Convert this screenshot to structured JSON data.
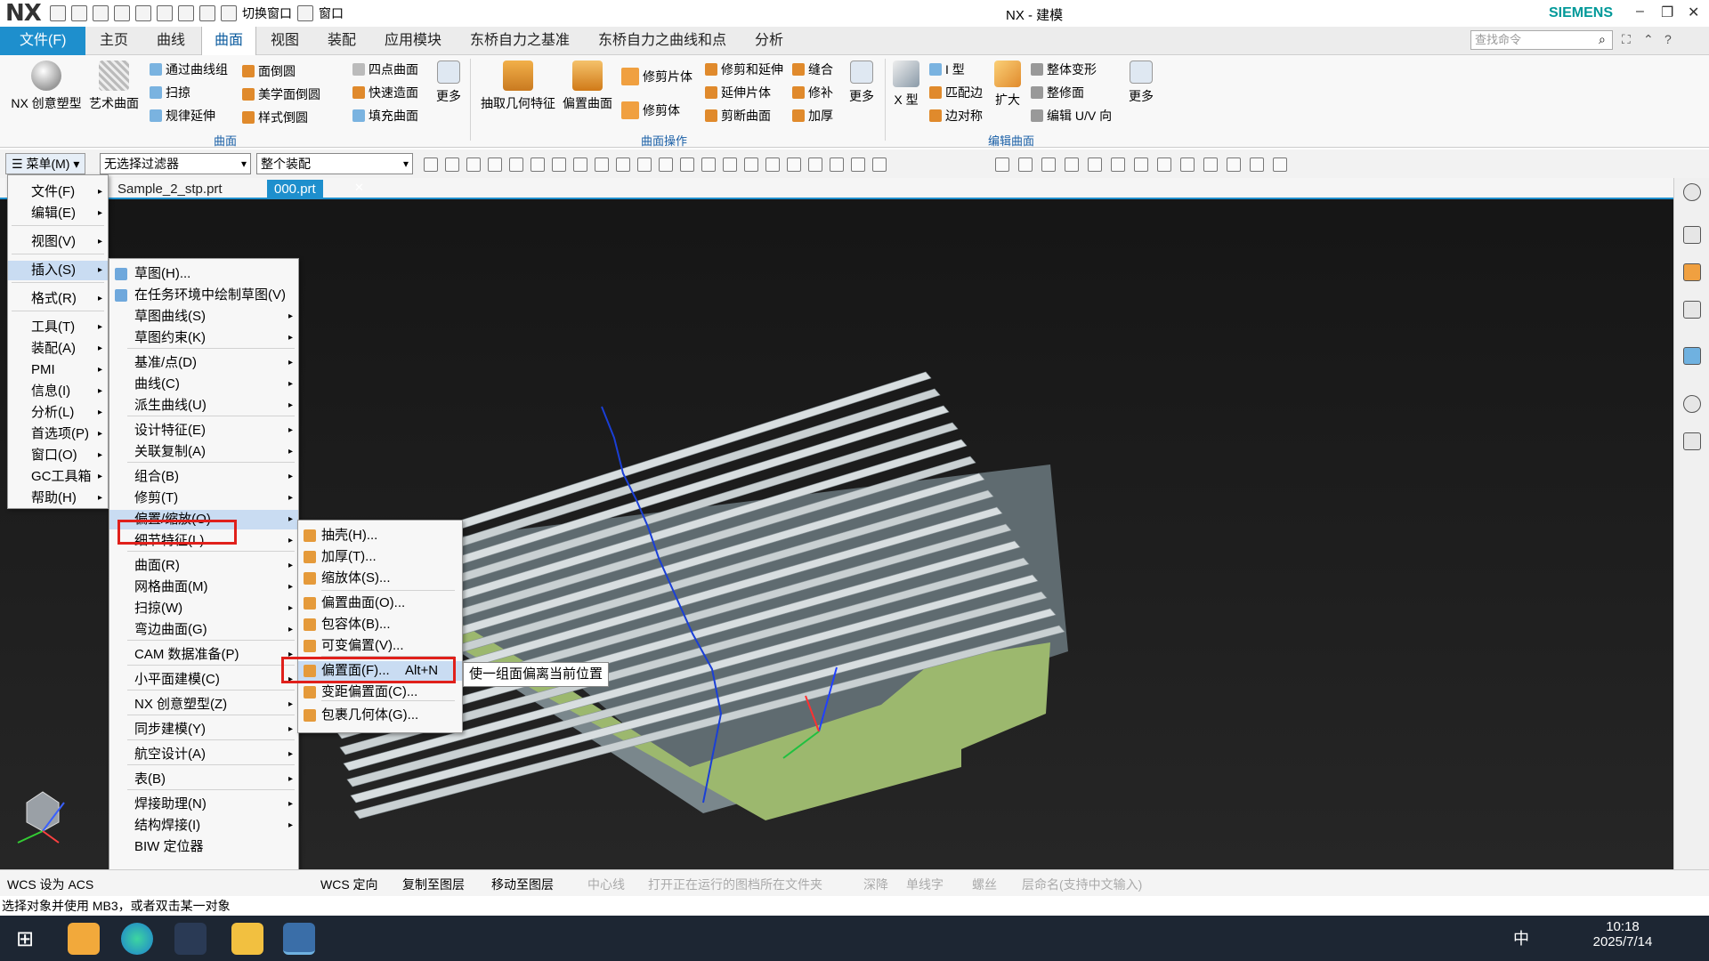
{
  "titlebar": {
    "logo": "NX",
    "switch_window": "切换窗口",
    "window": "窗口",
    "title": "NX - 建模",
    "brand": "SIEMENS"
  },
  "menubar": {
    "tabs": [
      "文件(F)",
      "主页",
      "曲线",
      "曲面",
      "视图",
      "装配",
      "应用模块",
      "东桥自力之基准",
      "东桥自力之曲线和点",
      "分析"
    ],
    "active": "曲面",
    "search_placeholder": "查找命令"
  },
  "ribbon": {
    "big": [
      "NX 创意塑型",
      "艺术曲面",
      "抽取几何特征",
      "偏置曲面",
      "X 型",
      "扩大"
    ],
    "col1": [
      "通过曲线组",
      "扫掠",
      "规律延伸"
    ],
    "col2": [
      "面倒圆",
      "美学面倒圆",
      "样式倒圆"
    ],
    "col3": [
      "四点曲面",
      "快速造面",
      "填充曲面"
    ],
    "more": "更多",
    "trim": [
      "修剪片体",
      "修剪体"
    ],
    "col4": [
      "修剪和延伸",
      "延伸片体",
      "剪断曲面"
    ],
    "col5": [
      "缝合",
      "修补",
      "加厚"
    ],
    "col6": [
      "I 型",
      "匹配边",
      "边对称"
    ],
    "col7": [
      "整体变形",
      "整修面",
      "编辑 U/V 向"
    ],
    "groups": [
      "曲面",
      "曲面操作",
      "编辑曲面"
    ]
  },
  "toolbar": {
    "menu_button": "菜单(M)",
    "filter": "无选择过滤器",
    "scope": "整个装配"
  },
  "tabs": [
    "Sample_2_stp.prt",
    "000.prt"
  ],
  "main_menu": [
    "文件(F)",
    "编辑(E)",
    "视图(V)",
    "插入(S)",
    "格式(R)",
    "工具(T)",
    "装配(A)",
    "PMI",
    "信息(I)",
    "分析(L)",
    "首选项(P)",
    "窗口(O)",
    "GC工具箱",
    "帮助(H)"
  ],
  "insert_menu": [
    "草图(H)...",
    "在任务环境中绘制草图(V)",
    "草图曲线(S)",
    "草图约束(K)",
    "基准/点(D)",
    "曲线(C)",
    "派生曲线(U)",
    "设计特征(E)",
    "关联复制(A)",
    "组合(B)",
    "修剪(T)",
    "偏置/缩放(O)",
    "细节特征(L)",
    "曲面(R)",
    "网格曲面(M)",
    "扫掠(W)",
    "弯边曲面(G)",
    "CAM 数据准备(P)",
    "小平面建模(C)",
    "NX 创意塑型(Z)",
    "同步建模(Y)",
    "航空设计(A)",
    "表(B)",
    "焊接助理(N)",
    "结构焊接(I)",
    "BIW 定位器"
  ],
  "offset_menu": [
    "抽壳(H)...",
    "加厚(T)...",
    "缩放体(S)...",
    "偏置曲面(O)...",
    "包容体(B)...",
    "可变偏置(V)...",
    "偏置面(F)...",
    "变距偏置面(C)...",
    "包裹几何体(G)..."
  ],
  "offset_shortcut": "Alt+N",
  "tooltip": "使一组面偏离当前位置",
  "statusbar": [
    "WCS 设为 ACS",
    "WCS 定向",
    "复制至图层",
    "移动至图层",
    "中心线",
    "打开正在运行的图档所在文件夹",
    "深降",
    "单线字",
    "螺丝",
    "层命名(支持中文输入)"
  ],
  "prompt": "选择对象并使用 MB3，或者双击某一对象",
  "taskbar": {
    "time": "10:18",
    "date": "2025/7/14",
    "ime": "中"
  },
  "colors": {
    "accent": "#1e8fcd",
    "highlight_box": "#e0201b",
    "part_green": "#9cb86e",
    "part_gray": "#6f7c82",
    "fins": "#c9d0d2"
  }
}
